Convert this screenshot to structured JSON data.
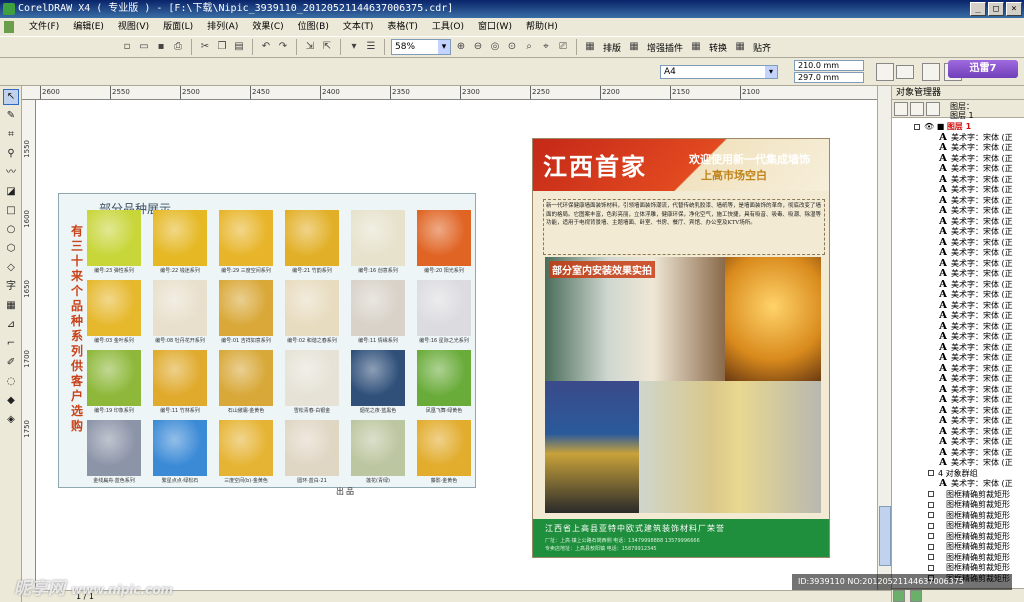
{
  "window": {
    "title": "CorelDRAW X4 ( 专业版 ) - [F:\\下载\\Nipic_3939110_20120521144637006375.cdr]",
    "controls": [
      "_",
      "□",
      "×"
    ]
  },
  "menu": [
    "文件(F)",
    "编辑(E)",
    "视图(V)",
    "版面(L)",
    "排列(A)",
    "效果(C)",
    "位图(B)",
    "文本(T)",
    "表格(T)",
    "工具(O)",
    "窗口(W)",
    "帮助(H)"
  ],
  "toolbar": {
    "zoom": "58%",
    "typeset_label": "排版",
    "enhance_plugin_label": "增强插件",
    "convert_label": "转换",
    "paste_label": "贴齐"
  },
  "propertybar": {
    "page_size": "A4",
    "width": "210.0 mm",
    "height": "297.0 mm",
    "promo": "迅雷7"
  },
  "ruler": {
    "h_ticks": [
      "2600",
      "2550",
      "2500",
      "2450",
      "2400",
      "2350",
      "2300",
      "2250",
      "2200",
      "2150",
      "2100"
    ],
    "v_ticks": [
      "1550",
      "1600",
      "1650",
      "1700",
      "1750"
    ]
  },
  "design1": {
    "title": "部分品种展示",
    "side_text": "有三十来个品种系列供客户选购",
    "swatch_colors": [
      [
        "#c8d63a",
        "#e5b824",
        "#e8b52a",
        "#e2b028",
        "#e6e2cc",
        "#e06424"
      ],
      [
        "#e6b82c",
        "#e8e0cc",
        "#d9a838",
        "#e8dcc0",
        "#d8d2c8",
        "#dcdce0"
      ],
      [
        "#8eb83a",
        "#e0aa2c",
        "#d8a838",
        "#e6e2d6",
        "#30507a",
        "#6aac3a"
      ],
      [
        "#8c94a8",
        "#3b8ad6",
        "#e6b434",
        "#e0d6c4",
        "#bcc6a0",
        "#e2ac2c"
      ]
    ],
    "swatch_labels": [
      [
        "编号:23 弹性系列",
        "编号:22 钱迷系列",
        "编号:29 三度空间系列",
        "编号:21 竹韵系列",
        "编号:16 创意系列",
        "编号:20 阳光系列"
      ],
      [
        "编号:03 金叶系列",
        "编号:08 牡丹花开系列",
        "编号:01 吉祥如意系列",
        "编号:02 和谐之春系列",
        "编号:11 情缘系列",
        "编号:16 星际之光系列"
      ],
      [
        "编号:19 印象系列",
        "编号:11 竹林系列",
        "石山傲霜·金黄色",
        "雪松青春·白银金",
        "烟花之夜·蓝黑色",
        "凤凰飞舞·绿黄色"
      ],
      [
        "金线扁舟·蓝色系列",
        "繁星点点·绿松石",
        "三度空间(b)·金黄色",
        "圆环·蓝白·21",
        "莲花(青绿)",
        "藤影·金黄色"
      ]
    ]
  },
  "design2": {
    "brand": "江西首家",
    "slogan": "欢迎使用新一代集成墙饰",
    "sub": "上高市场空白",
    "body": "新一代环保健康墙面装饰材料，引领墙面装饰潮流，代替传统乳胶漆、墙纸等，是墙面装饰的革命，彻底改变了墙面的格局。它图案丰富，色彩亮丽，立体浮雕，健康环保，净化空气，施工快捷，具有吸音、吸毒、吸潮、除湿等功能，适用于电视背景墙、主题墙面、卧室、书房、餐厅、宾馆、办公室及KTV场所。",
    "photo_label": "部分室内安装效果实拍",
    "company": "江西省上高县亚特中欧式建筑装饰材料厂荣誉",
    "contact1": "厂址：上高·镇上公路石岗西侧    电话：13479998888    13579996666",
    "contact2": "专卖店地址：上高县敖阳镇    电话：15879912345",
    "print_mark": "出品"
  },
  "watermark": {
    "site": "昵享网",
    "url": "www.nipic.com"
  },
  "id_overlay": "ID:3939110 NO:20120521144637006375",
  "status": "1 / 1",
  "object_manager": {
    "title": "对象管理器",
    "layers_label": "图层：",
    "layers_value": "图层 1",
    "layer_name": "图层 1",
    "text_items": [
      "美术字：宋体 (正",
      "美术字：宋体 (正",
      "美术字：宋体 (正",
      "美术字：宋体 (正",
      "美术字：宋体 (正",
      "美术字：宋体 (正",
      "美术字：宋体 (正",
      "美术字：宋体 (正",
      "美术字：宋体 (正",
      "美术字：宋体 (正",
      "美术字：宋体 (正",
      "美术字：宋体 (正",
      "美术字：宋体 (正",
      "美术字：宋体 (正",
      "美术字：宋体 (正",
      "美术字：宋体 (正",
      "美术字：宋体 (正",
      "美术字：宋体 (正",
      "美术字：宋体 (正",
      "美术字：宋体 (正",
      "美术字：宋体 (正",
      "美术字：宋体 (正",
      "美术字：宋体 (正",
      "美术字：宋体 (正",
      "美术字：宋体 (正",
      "美术字：宋体 (正",
      "美术字：宋体 (正",
      "美术字：宋体 (正",
      "美术字：宋体 (正",
      "美术字：宋体 (正",
      "美术字：宋体 (正",
      "美术字：宋体 (正"
    ],
    "group_label": "4 对象群组",
    "group_child": "美术字：宋体 (正",
    "clip_items": [
      "图框精确剪裁矩形",
      "图框精确剪裁矩形",
      "图框精确剪裁矩形",
      "图框精确剪裁矩形",
      "图框精确剪裁矩形",
      "图框精确剪裁矩形",
      "图框精确剪裁矩形",
      "图框精确剪裁矩形",
      "图框精确剪裁矩形"
    ]
  }
}
